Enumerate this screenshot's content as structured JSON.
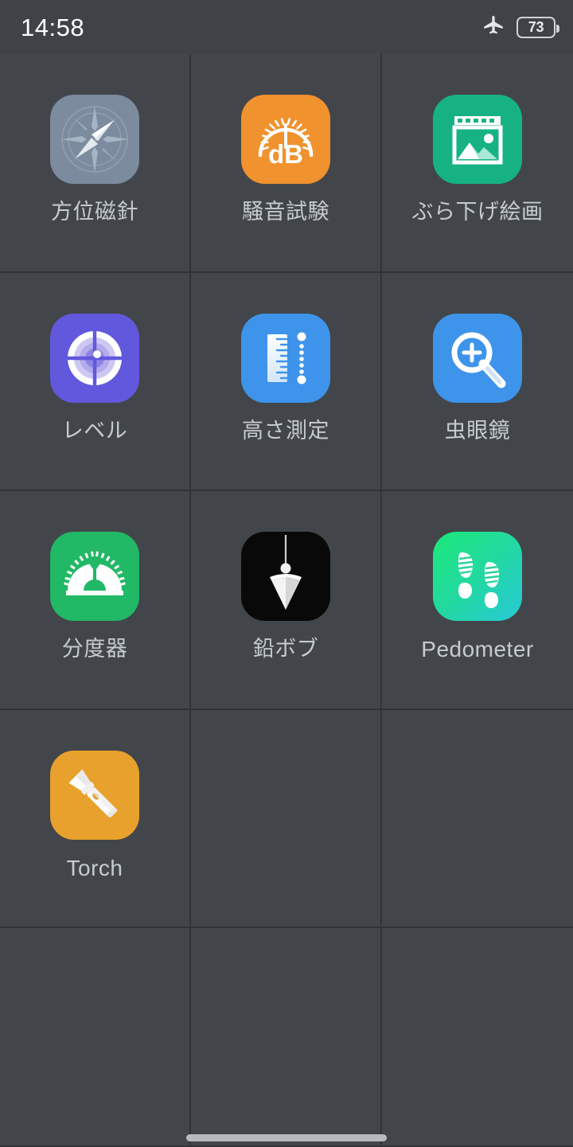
{
  "statusbar": {
    "clock": "14:58",
    "airplane_icon": "airplane-mode-icon",
    "battery_level": "73",
    "battery_icon": "battery-icon"
  },
  "apps": [
    {
      "label": "方位磁針",
      "icon": "compass-icon",
      "style": "bg-compass",
      "latin": false
    },
    {
      "label": "騒音試験",
      "icon": "decibel-meter-icon",
      "style": "bg-db",
      "latin": false
    },
    {
      "label": "ぶら下げ絵画",
      "icon": "hanging-picture-icon",
      "style": "bg-picture",
      "latin": false
    },
    {
      "label": "レベル",
      "icon": "bubble-level-icon",
      "style": "bg-level",
      "latin": false
    },
    {
      "label": "高さ測定",
      "icon": "height-ruler-icon",
      "style": "bg-ruler",
      "latin": false
    },
    {
      "label": "虫眼鏡",
      "icon": "magnifier-icon",
      "style": "bg-magnify",
      "latin": false
    },
    {
      "label": "分度器",
      "icon": "protractor-icon",
      "style": "bg-protract",
      "latin": false
    },
    {
      "label": "鉛ボブ",
      "icon": "plumb-bob-icon",
      "style": "bg-plumb",
      "latin": false
    },
    {
      "label": "Pedometer",
      "icon": "footprints-icon",
      "style": "bg-pedometer",
      "latin": true
    },
    {
      "label": "Torch",
      "icon": "flashlight-icon",
      "style": "bg-torch",
      "latin": true
    }
  ],
  "empty_cells": 5,
  "home_indicator": "home-indicator",
  "colors": {
    "page_background": "#42464a",
    "grid_line": "#2f3337",
    "label_text": "#c6cbd0",
    "status_text": "#ffffff"
  }
}
